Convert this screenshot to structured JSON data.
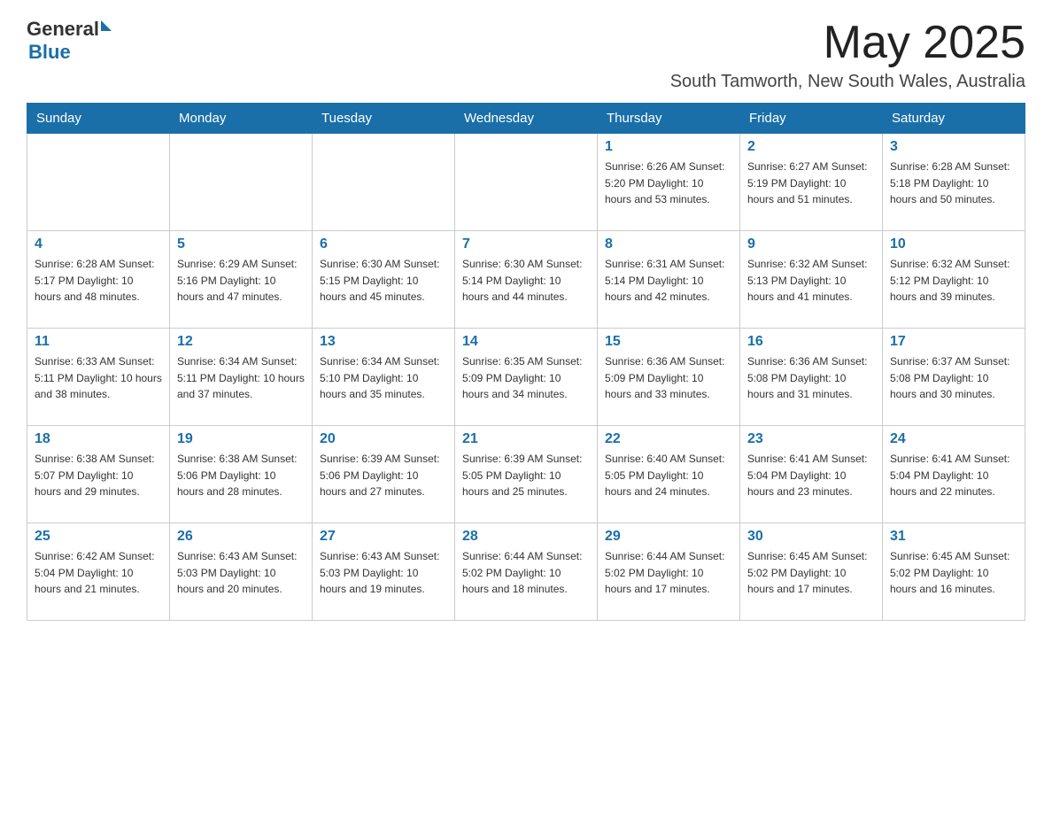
{
  "header": {
    "logo_general": "General",
    "logo_blue": "Blue",
    "month_title": "May 2025",
    "location": "South Tamworth, New South Wales, Australia"
  },
  "days_of_week": [
    "Sunday",
    "Monday",
    "Tuesday",
    "Wednesday",
    "Thursday",
    "Friday",
    "Saturday"
  ],
  "weeks": [
    [
      {
        "day": "",
        "info": ""
      },
      {
        "day": "",
        "info": ""
      },
      {
        "day": "",
        "info": ""
      },
      {
        "day": "",
        "info": ""
      },
      {
        "day": "1",
        "info": "Sunrise: 6:26 AM\nSunset: 5:20 PM\nDaylight: 10 hours\nand 53 minutes."
      },
      {
        "day": "2",
        "info": "Sunrise: 6:27 AM\nSunset: 5:19 PM\nDaylight: 10 hours\nand 51 minutes."
      },
      {
        "day": "3",
        "info": "Sunrise: 6:28 AM\nSunset: 5:18 PM\nDaylight: 10 hours\nand 50 minutes."
      }
    ],
    [
      {
        "day": "4",
        "info": "Sunrise: 6:28 AM\nSunset: 5:17 PM\nDaylight: 10 hours\nand 48 minutes."
      },
      {
        "day": "5",
        "info": "Sunrise: 6:29 AM\nSunset: 5:16 PM\nDaylight: 10 hours\nand 47 minutes."
      },
      {
        "day": "6",
        "info": "Sunrise: 6:30 AM\nSunset: 5:15 PM\nDaylight: 10 hours\nand 45 minutes."
      },
      {
        "day": "7",
        "info": "Sunrise: 6:30 AM\nSunset: 5:14 PM\nDaylight: 10 hours\nand 44 minutes."
      },
      {
        "day": "8",
        "info": "Sunrise: 6:31 AM\nSunset: 5:14 PM\nDaylight: 10 hours\nand 42 minutes."
      },
      {
        "day": "9",
        "info": "Sunrise: 6:32 AM\nSunset: 5:13 PM\nDaylight: 10 hours\nand 41 minutes."
      },
      {
        "day": "10",
        "info": "Sunrise: 6:32 AM\nSunset: 5:12 PM\nDaylight: 10 hours\nand 39 minutes."
      }
    ],
    [
      {
        "day": "11",
        "info": "Sunrise: 6:33 AM\nSunset: 5:11 PM\nDaylight: 10 hours\nand 38 minutes."
      },
      {
        "day": "12",
        "info": "Sunrise: 6:34 AM\nSunset: 5:11 PM\nDaylight: 10 hours\nand 37 minutes."
      },
      {
        "day": "13",
        "info": "Sunrise: 6:34 AM\nSunset: 5:10 PM\nDaylight: 10 hours\nand 35 minutes."
      },
      {
        "day": "14",
        "info": "Sunrise: 6:35 AM\nSunset: 5:09 PM\nDaylight: 10 hours\nand 34 minutes."
      },
      {
        "day": "15",
        "info": "Sunrise: 6:36 AM\nSunset: 5:09 PM\nDaylight: 10 hours\nand 33 minutes."
      },
      {
        "day": "16",
        "info": "Sunrise: 6:36 AM\nSunset: 5:08 PM\nDaylight: 10 hours\nand 31 minutes."
      },
      {
        "day": "17",
        "info": "Sunrise: 6:37 AM\nSunset: 5:08 PM\nDaylight: 10 hours\nand 30 minutes."
      }
    ],
    [
      {
        "day": "18",
        "info": "Sunrise: 6:38 AM\nSunset: 5:07 PM\nDaylight: 10 hours\nand 29 minutes."
      },
      {
        "day": "19",
        "info": "Sunrise: 6:38 AM\nSunset: 5:06 PM\nDaylight: 10 hours\nand 28 minutes."
      },
      {
        "day": "20",
        "info": "Sunrise: 6:39 AM\nSunset: 5:06 PM\nDaylight: 10 hours\nand 27 minutes."
      },
      {
        "day": "21",
        "info": "Sunrise: 6:39 AM\nSunset: 5:05 PM\nDaylight: 10 hours\nand 25 minutes."
      },
      {
        "day": "22",
        "info": "Sunrise: 6:40 AM\nSunset: 5:05 PM\nDaylight: 10 hours\nand 24 minutes."
      },
      {
        "day": "23",
        "info": "Sunrise: 6:41 AM\nSunset: 5:04 PM\nDaylight: 10 hours\nand 23 minutes."
      },
      {
        "day": "24",
        "info": "Sunrise: 6:41 AM\nSunset: 5:04 PM\nDaylight: 10 hours\nand 22 minutes."
      }
    ],
    [
      {
        "day": "25",
        "info": "Sunrise: 6:42 AM\nSunset: 5:04 PM\nDaylight: 10 hours\nand 21 minutes."
      },
      {
        "day": "26",
        "info": "Sunrise: 6:43 AM\nSunset: 5:03 PM\nDaylight: 10 hours\nand 20 minutes."
      },
      {
        "day": "27",
        "info": "Sunrise: 6:43 AM\nSunset: 5:03 PM\nDaylight: 10 hours\nand 19 minutes."
      },
      {
        "day": "28",
        "info": "Sunrise: 6:44 AM\nSunset: 5:02 PM\nDaylight: 10 hours\nand 18 minutes."
      },
      {
        "day": "29",
        "info": "Sunrise: 6:44 AM\nSunset: 5:02 PM\nDaylight: 10 hours\nand 17 minutes."
      },
      {
        "day": "30",
        "info": "Sunrise: 6:45 AM\nSunset: 5:02 PM\nDaylight: 10 hours\nand 17 minutes."
      },
      {
        "day": "31",
        "info": "Sunrise: 6:45 AM\nSunset: 5:02 PM\nDaylight: 10 hours\nand 16 minutes."
      }
    ]
  ]
}
